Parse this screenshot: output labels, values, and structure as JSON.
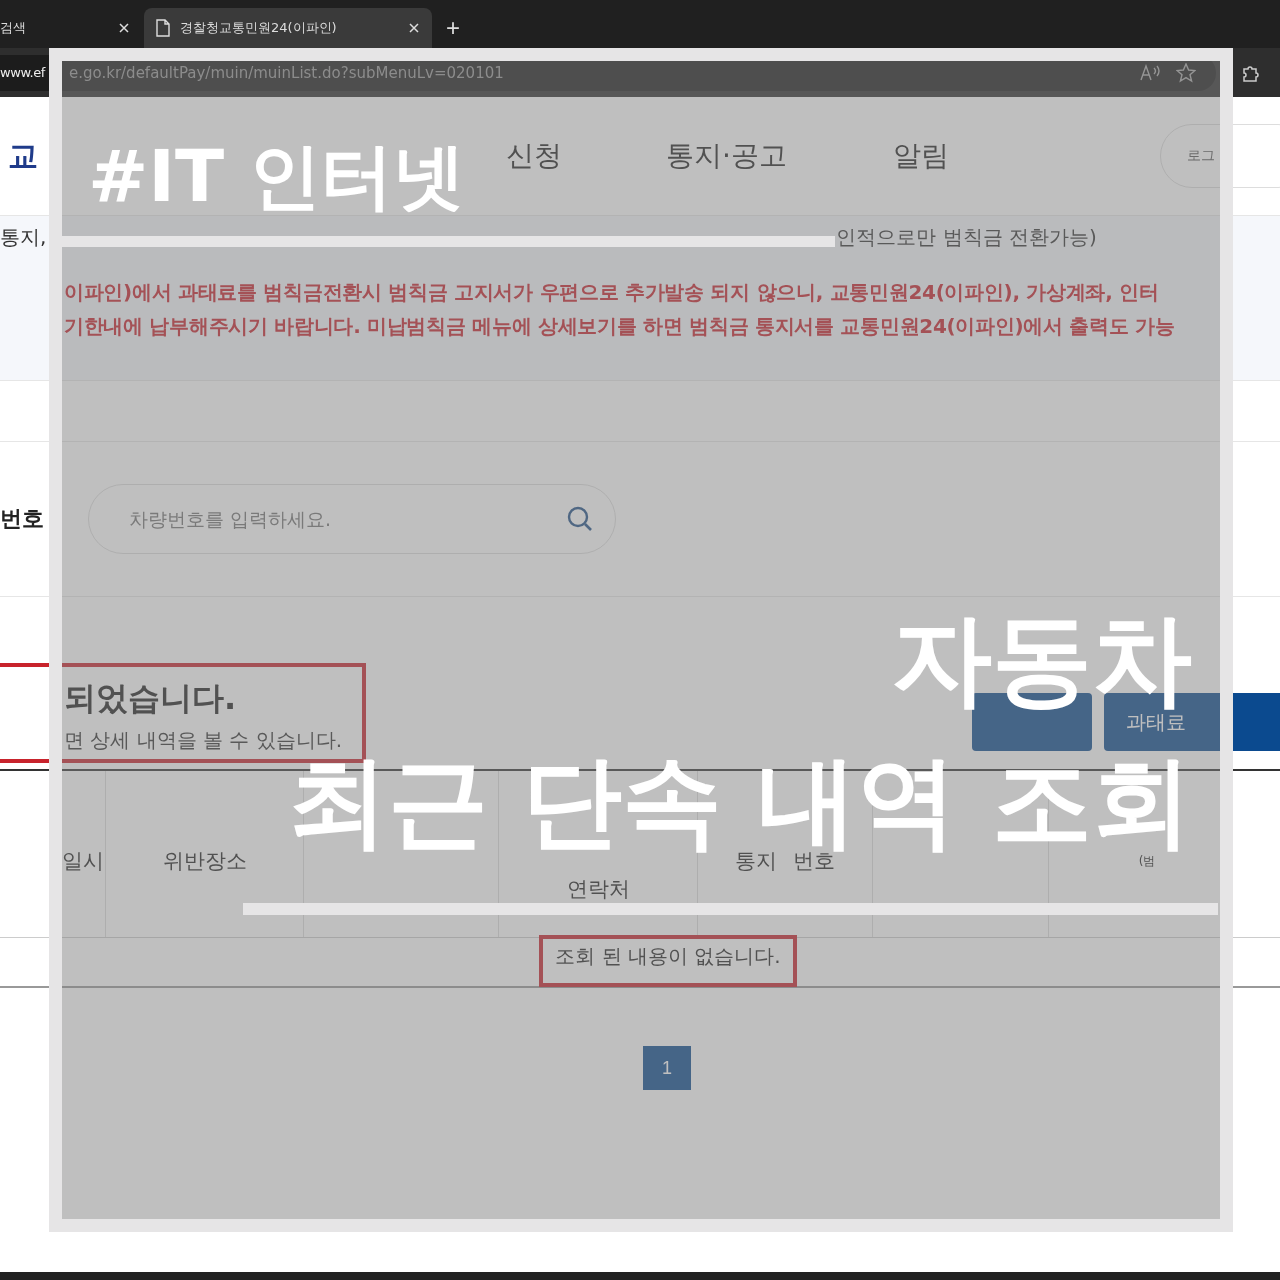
{
  "browser": {
    "tabs": [
      {
        "title": "검색",
        "selected": false
      },
      {
        "title": "경찰청교통민원24(이파인)",
        "selected": true
      }
    ],
    "new_tab": "+",
    "address": {
      "host": "www.ef",
      "path": "e.go.kr/defaultPay/muin/muinList.do?subMenuLv=020101"
    }
  },
  "header": {
    "logo": "교",
    "nav": [
      "신청",
      "통지·공고",
      "알림"
    ],
    "login": "로그"
  },
  "notice": {
    "line_parts": [
      "통지,",
      "인적으로만 범칙금 전환가능)"
    ],
    "warning_lines": [
      "이파인)에서 과태료를 범칙금전환시 범칙금 고지서가 우편으로 추가발송 되지 않으니, 교통민원24(이파인), 가상계좌, 인터",
      "기한내에 납부해주시기 바랍니다. 미납범칙금 메뉴에 상세보기를 하면 범칙금 통지서를 교통민원24(이파인)에서 출력도 가능"
    ]
  },
  "search": {
    "label": "번호",
    "placeholder": "차량번호를 입력하세요."
  },
  "result": {
    "title": "되었습니다.",
    "hint": "면 상세 내역을 볼 수 있습니다.",
    "buttons": [
      {
        "kind": "download"
      },
      {
        "label": "과태료",
        "kind": "plain"
      }
    ]
  },
  "table": {
    "columns": [
      {
        "parts": [
          "일시"
        ]
      },
      {
        "parts": [
          "위반장소"
        ]
      },
      {},
      {
        "parts": [
          "연락처"
        ]
      },
      {
        "parts": [
          "통지",
          "번호"
        ]
      },
      {},
      {
        "parts": [
          "(범"
        ]
      }
    ],
    "empty": "조회 된 내용이 없습니다."
  },
  "pagination": [
    {
      "label": "1",
      "selected": true
    }
  ],
  "overlay": {
    "tag": "#IT 인터넷",
    "title_lines": [
      "자동차",
      "최근 단속 내역 조회"
    ]
  }
}
